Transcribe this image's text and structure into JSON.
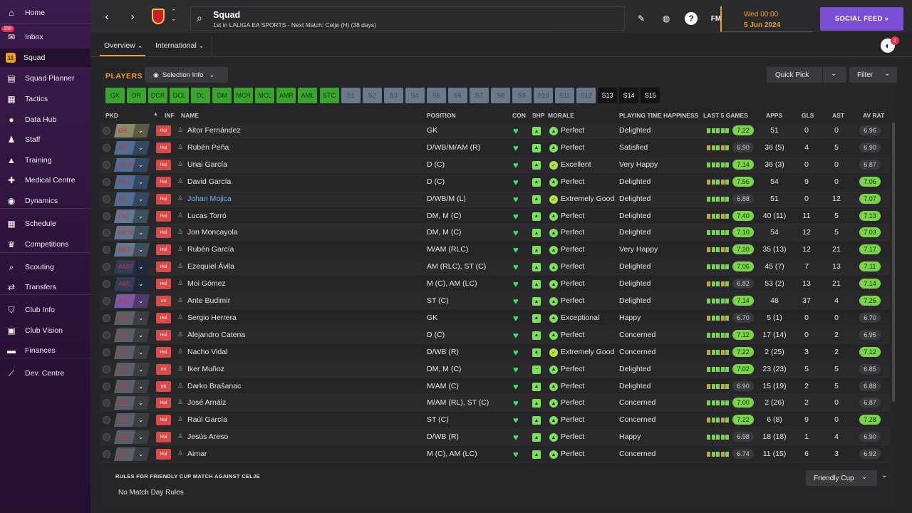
{
  "sidebar": {
    "items": [
      {
        "label": "Home",
        "icon": "home-icon",
        "glyph": "⌂"
      },
      {
        "label": "Inbox",
        "icon": "inbox-icon",
        "glyph": "✉",
        "badge": "150"
      },
      {
        "label": "Squad",
        "icon": "squad-icon",
        "glyph": "11",
        "active": true
      },
      {
        "label": "Squad Planner",
        "icon": "planner-icon",
        "glyph": "▤"
      },
      {
        "label": "Tactics",
        "icon": "tactics-icon",
        "glyph": "▦"
      },
      {
        "label": "Data Hub",
        "icon": "data-hub-icon",
        "glyph": "●"
      },
      {
        "label": "Staff",
        "icon": "staff-icon",
        "glyph": "♟"
      },
      {
        "label": "Training",
        "icon": "training-icon",
        "glyph": "▲"
      },
      {
        "label": "Medical Centre",
        "icon": "medical-icon",
        "glyph": "✚"
      },
      {
        "label": "Dynamics",
        "icon": "dynamics-icon",
        "glyph": "◉"
      },
      {
        "label": "Schedule",
        "icon": "schedule-icon",
        "glyph": "▦"
      },
      {
        "label": "Competitions",
        "icon": "trophy-icon",
        "glyph": "♛"
      },
      {
        "label": "Scouting",
        "icon": "scouting-icon",
        "glyph": "⌕"
      },
      {
        "label": "Transfers",
        "icon": "transfers-icon",
        "glyph": "⇄"
      },
      {
        "label": "Club Info",
        "icon": "club-info-icon",
        "glyph": "⛉"
      },
      {
        "label": "Club Vision",
        "icon": "club-vision-icon",
        "glyph": "▣"
      },
      {
        "label": "Finances",
        "icon": "finances-icon",
        "glyph": "▬"
      },
      {
        "label": "Dev. Centre",
        "icon": "dev-centre-icon",
        "glyph": "⟋"
      }
    ]
  },
  "topbar": {
    "back": "‹",
    "forward": "›",
    "updown": "⌃⌄",
    "search_glyph": "⌕",
    "title": "Squad",
    "subtitle": "1st in LALIGA EA SPORTS - Next Match: Celje (H) (38 days)",
    "edit_glyph": "✎",
    "globe_glyph": "◍",
    "help_glyph": "?",
    "fm_label": "FM",
    "date_day": "Wed 00:00",
    "date_full": "5 Jun 2024",
    "social_label": "SOCIAL FEED  »",
    "ball_glyph": "◐",
    "notif_count": "2"
  },
  "subnav": {
    "tabs": [
      {
        "label": "Overview",
        "active": true
      },
      {
        "label": "International",
        "active": false
      }
    ]
  },
  "panel": {
    "players_title": "PLAYERS",
    "selection_info": "Selection Info",
    "quick_pick": "Quick Pick",
    "filter": "Filter",
    "eye_glyph": "◉",
    "chev": "⌄"
  },
  "positions": [
    {
      "label": "GK",
      "style": "green"
    },
    {
      "label": "DR",
      "style": "green"
    },
    {
      "label": "DCR",
      "style": "green"
    },
    {
      "label": "DCL",
      "style": "green"
    },
    {
      "label": "DL",
      "style": "green"
    },
    {
      "label": "DM",
      "style": "green"
    },
    {
      "label": "MCR",
      "style": "green"
    },
    {
      "label": "MCL",
      "style": "green"
    },
    {
      "label": "AMR",
      "style": "green"
    },
    {
      "label": "AML",
      "style": "green"
    },
    {
      "label": "STC",
      "style": "green"
    },
    {
      "label": "S1",
      "style": "grey"
    },
    {
      "label": "S2",
      "style": "grey"
    },
    {
      "label": "S3",
      "style": "grey"
    },
    {
      "label": "S4",
      "style": "grey"
    },
    {
      "label": "S5",
      "style": "grey"
    },
    {
      "label": "S6",
      "style": "grey"
    },
    {
      "label": "S7",
      "style": "grey"
    },
    {
      "label": "S8",
      "style": "grey"
    },
    {
      "label": "S9",
      "style": "grey"
    },
    {
      "label": "S10",
      "style": "grey"
    },
    {
      "label": "S11",
      "style": "grey"
    },
    {
      "label": "S12",
      "style": "grey"
    },
    {
      "label": "S13",
      "style": "plain"
    },
    {
      "label": "S14",
      "style": "plain"
    },
    {
      "label": "S15",
      "style": "plain"
    }
  ],
  "columns": {
    "pkd": "PKD",
    "sort": "▲",
    "inf": "INF",
    "name": "NAME",
    "position": "POSITION",
    "con": "CON",
    "shp": "SHP",
    "morale": "MORALE",
    "pth": "PLAYING TIME HAPPINESS",
    "last5": "LAST 5 GAMES",
    "apps": "APPS",
    "gls": "GLS",
    "ast": "AST",
    "avrat": "AV RAT"
  },
  "players": [
    {
      "pkd": "GK",
      "inf": "Hol",
      "name": "Aitor Fernández",
      "position": "GK",
      "morale": "Perfect",
      "pth": "Delighted",
      "form": "7.22",
      "form_hi": true,
      "apps": "51",
      "gls": "0",
      "ast": "0",
      "avrat": "6.96",
      "avrat_hi": false,
      "tone": "olive"
    },
    {
      "pkd": "DR",
      "inf": "Hol",
      "name": "Rubén Peña",
      "position": "D/WB/M/AM (R)",
      "morale": "Perfect",
      "pth": "Satisfied",
      "form": "6.90",
      "form_hi": false,
      "apps": "36 (5)",
      "gls": "4",
      "ast": "5",
      "avrat": "6.90",
      "avrat_hi": false,
      "tone": "blue"
    },
    {
      "pkd": "DCR",
      "inf": "Hol",
      "name": "Unai García",
      "position": "D (C)",
      "morale": "Excellent",
      "pth": "Very Happy",
      "form": "7.14",
      "form_hi": true,
      "apps": "36 (3)",
      "gls": "0",
      "ast": "0",
      "avrat": "6.87",
      "avrat_hi": false,
      "tone": "blue"
    },
    {
      "pkd": "DCL",
      "inf": "Hol",
      "name": "David García",
      "position": "D (C)",
      "morale": "Perfect",
      "pth": "Delighted",
      "form": "7.56",
      "form_hi": true,
      "apps": "54",
      "gls": "9",
      "ast": "0",
      "avrat": "7.06",
      "avrat_hi": true,
      "tone": "blue"
    },
    {
      "pkd": "DL",
      "inf": "Hol",
      "name": "Johan Mojica",
      "position": "D/WB/M (L)",
      "morale": "Extremely Good",
      "pth": "Delighted",
      "form": "6.88",
      "form_hi": false,
      "apps": "51",
      "gls": "0",
      "ast": "12",
      "avrat": "7.07",
      "avrat_hi": true,
      "tone": "blue",
      "link": true
    },
    {
      "pkd": "DM",
      "inf": "Hol",
      "name": "Lucas Torró",
      "position": "DM, M (C)",
      "morale": "Perfect",
      "pth": "Delighted",
      "form": "7.40",
      "form_hi": true,
      "apps": "40 (11)",
      "gls": "11",
      "ast": "5",
      "avrat": "7.13",
      "avrat_hi": true,
      "tone": "slate"
    },
    {
      "pkd": "MCR",
      "inf": "Hol",
      "name": "Jon Moncayola",
      "position": "DM, M (C)",
      "morale": "Perfect",
      "pth": "Delighted",
      "form": "7.10",
      "form_hi": true,
      "apps": "54",
      "gls": "12",
      "ast": "5",
      "avrat": "7.03",
      "avrat_hi": true,
      "tone": "slate"
    },
    {
      "pkd": "MCL",
      "inf": "Hol",
      "name": "Rubén García",
      "position": "M/AM (RLC)",
      "morale": "Perfect",
      "pth": "Very Happy",
      "form": "7.20",
      "form_hi": true,
      "apps": "35 (13)",
      "gls": "12",
      "ast": "21",
      "avrat": "7.17",
      "avrat_hi": true,
      "tone": "slate"
    },
    {
      "pkd": "AMR",
      "inf": "Hol",
      "name": "Ezequiel Ávila",
      "position": "AM (RLC), ST (C)",
      "morale": "Perfect",
      "pth": "Delighted",
      "form": "7.06",
      "form_hi": true,
      "apps": "45 (7)",
      "gls": "7",
      "ast": "13",
      "avrat": "7.11",
      "avrat_hi": true,
      "tone": "navy"
    },
    {
      "pkd": "AML",
      "inf": "Hol",
      "name": "Moi Gómez",
      "position": "M (C), AM (LC)",
      "morale": "Perfect",
      "pth": "Delighted",
      "form": "6.82",
      "form_hi": false,
      "apps": "53 (2)",
      "gls": "13",
      "ast": "21",
      "avrat": "7.14",
      "avrat_hi": true,
      "tone": "navy"
    },
    {
      "pkd": "STC",
      "inf": "Int",
      "name": "Ante Budimir",
      "position": "ST (C)",
      "morale": "Perfect",
      "pth": "Delighted",
      "form": "7.14",
      "form_hi": true,
      "apps": "48",
      "gls": "37",
      "ast": "4",
      "avrat": "7.26",
      "avrat_hi": true,
      "tone": "purple"
    },
    {
      "pkd": "S1",
      "inf": "Hol",
      "name": "Sergio Herrera",
      "position": "GK",
      "morale": "Exceptional",
      "pth": "Happy",
      "form": "6.70",
      "form_hi": false,
      "apps": "5 (1)",
      "gls": "0",
      "ast": "0",
      "avrat": "6.70",
      "avrat_hi": false,
      "tone": "grey"
    },
    {
      "pkd": "S2",
      "inf": "Hol",
      "name": "Alejandro Catena",
      "position": "D (C)",
      "morale": "Perfect",
      "pth": "Concerned",
      "form": "7.12",
      "form_hi": true,
      "apps": "17 (14)",
      "gls": "0",
      "ast": "2",
      "avrat": "6.95",
      "avrat_hi": false,
      "tone": "grey"
    },
    {
      "pkd": "S3",
      "inf": "Hol",
      "name": "Nacho Vidal",
      "position": "D/WB (R)",
      "morale": "Extremely Good",
      "pth": "Concerned",
      "form": "7.22",
      "form_hi": true,
      "apps": "2 (25)",
      "gls": "3",
      "ast": "2",
      "avrat": "7.12",
      "avrat_hi": true,
      "tone": "grey"
    },
    {
      "pkd": "S4",
      "inf": "Int",
      "name": "Iker Muñoz",
      "position": "DM, M (C)",
      "morale": "Perfect",
      "pth": "Delighted",
      "form": "7.02",
      "form_hi": true,
      "apps": "23 (23)",
      "gls": "5",
      "ast": "5",
      "avrat": "6.85",
      "avrat_hi": false,
      "tone": "grey",
      "shp_minus": true
    },
    {
      "pkd": "S5",
      "inf": "Int",
      "name": "Darko Brašanac",
      "position": "M/AM (C)",
      "morale": "Perfect",
      "pth": "Delighted",
      "form": "6.90",
      "form_hi": false,
      "apps": "15 (19)",
      "gls": "2",
      "ast": "5",
      "avrat": "6.88",
      "avrat_hi": false,
      "tone": "grey"
    },
    {
      "pkd": "S6",
      "inf": "Hol",
      "name": "José Arnáiz",
      "position": "M/AM (RL), ST (C)",
      "morale": "Perfect",
      "pth": "Concerned",
      "form": "7.00",
      "form_hi": true,
      "apps": "2 (26)",
      "gls": "2",
      "ast": "0",
      "avrat": "6.87",
      "avrat_hi": false,
      "tone": "grey"
    },
    {
      "pkd": "S7",
      "inf": "Hol",
      "name": "Raúl García",
      "position": "ST (C)",
      "morale": "Perfect",
      "pth": "Concerned",
      "form": "7.22",
      "form_hi": true,
      "apps": "6 (8)",
      "gls": "9",
      "ast": "0",
      "avrat": "7.28",
      "avrat_hi": true,
      "tone": "grey"
    },
    {
      "pkd": "S8",
      "inf": "Hol",
      "name": "Jesús Areso",
      "position": "D/WB (R)",
      "morale": "Perfect",
      "pth": "Happy",
      "form": "6.98",
      "form_hi": false,
      "apps": "18 (18)",
      "gls": "1",
      "ast": "4",
      "avrat": "6.90",
      "avrat_hi": false,
      "tone": "grey"
    },
    {
      "pkd": "S9",
      "inf": "Hol",
      "name": "Aimar",
      "position": "M (C), AM (LC)",
      "morale": "Perfect",
      "pth": "Concerned",
      "form": "6.74",
      "form_hi": false,
      "apps": "11 (15)",
      "gls": "6",
      "ast": "3",
      "avrat": "6.92",
      "avrat_hi": false,
      "tone": "grey"
    }
  ],
  "rules": {
    "title": "RULES FOR FRIENDLY CUP MATCH AGAINST CELJE",
    "text": "No Match Day Rules",
    "cup_label": "Friendly Cup"
  },
  "colors": {
    "accent": "#f0a020",
    "social": "#7a4fd6",
    "positive": "#7ad34a",
    "alert": "#e4304c"
  }
}
